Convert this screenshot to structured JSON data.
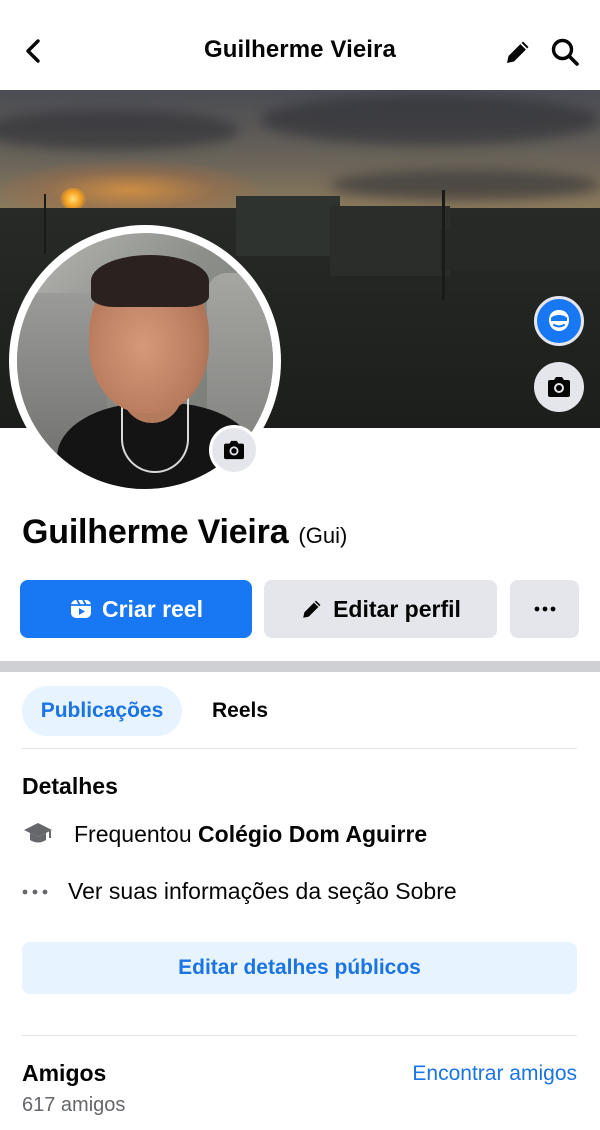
{
  "header": {
    "title": "Guilherme Vieira",
    "back_icon": "chevron-left-icon",
    "edit_icon": "pencil-icon",
    "search_icon": "search-icon"
  },
  "profile": {
    "name": "Guilherme Vieira",
    "nickname": "(Gui)"
  },
  "actions": {
    "create_reel": "Criar reel",
    "edit_profile": "Editar perfil",
    "more": "···"
  },
  "tabs": [
    {
      "label": "Publicações",
      "active": true
    },
    {
      "label": "Reels",
      "active": false
    }
  ],
  "details": {
    "title": "Detalhes",
    "studied_prefix": "Frequentou ",
    "studied_school": "Colégio Dom Aguirre",
    "see_about": "Ver suas informações da seção Sobre",
    "edit_public": "Editar detalhes públicos"
  },
  "friends": {
    "title": "Amigos",
    "count": "617 amigos",
    "find": "Encontrar amigos"
  },
  "colors": {
    "primary": "#1877f2",
    "link": "#1b74e4",
    "secondary_bg": "#e4e6eb",
    "tab_active_bg": "#e7f3ff"
  }
}
